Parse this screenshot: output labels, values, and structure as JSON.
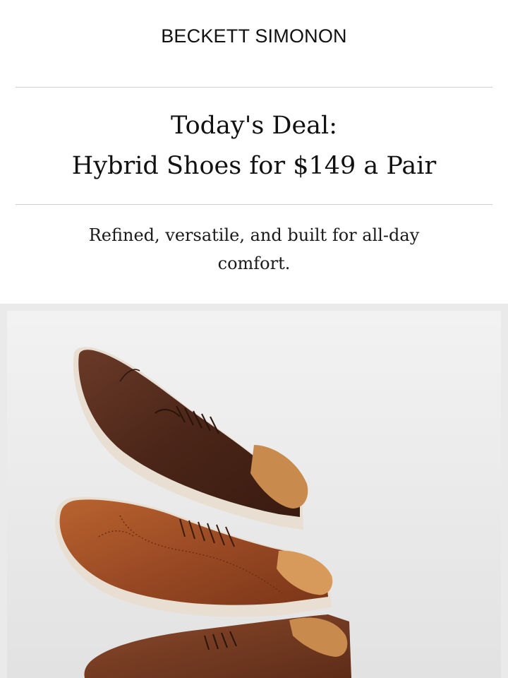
{
  "header": {
    "brand": "BECKETT SIMONON"
  },
  "hero_text": {
    "headline_line1": "Today's Deal:",
    "headline_line2": "Hybrid Shoes for $149 a Pair",
    "subtext": "Refined, versatile, and built for all-day comfort."
  },
  "product_image": {
    "description_icon": "shoe-stack-image",
    "colors": {
      "dark_brown": "#4a2518",
      "cognac": "#9a4a24",
      "medium_brown": "#6b3520",
      "sole": "#e8dfd2",
      "lining": "#c98a4e"
    }
  }
}
